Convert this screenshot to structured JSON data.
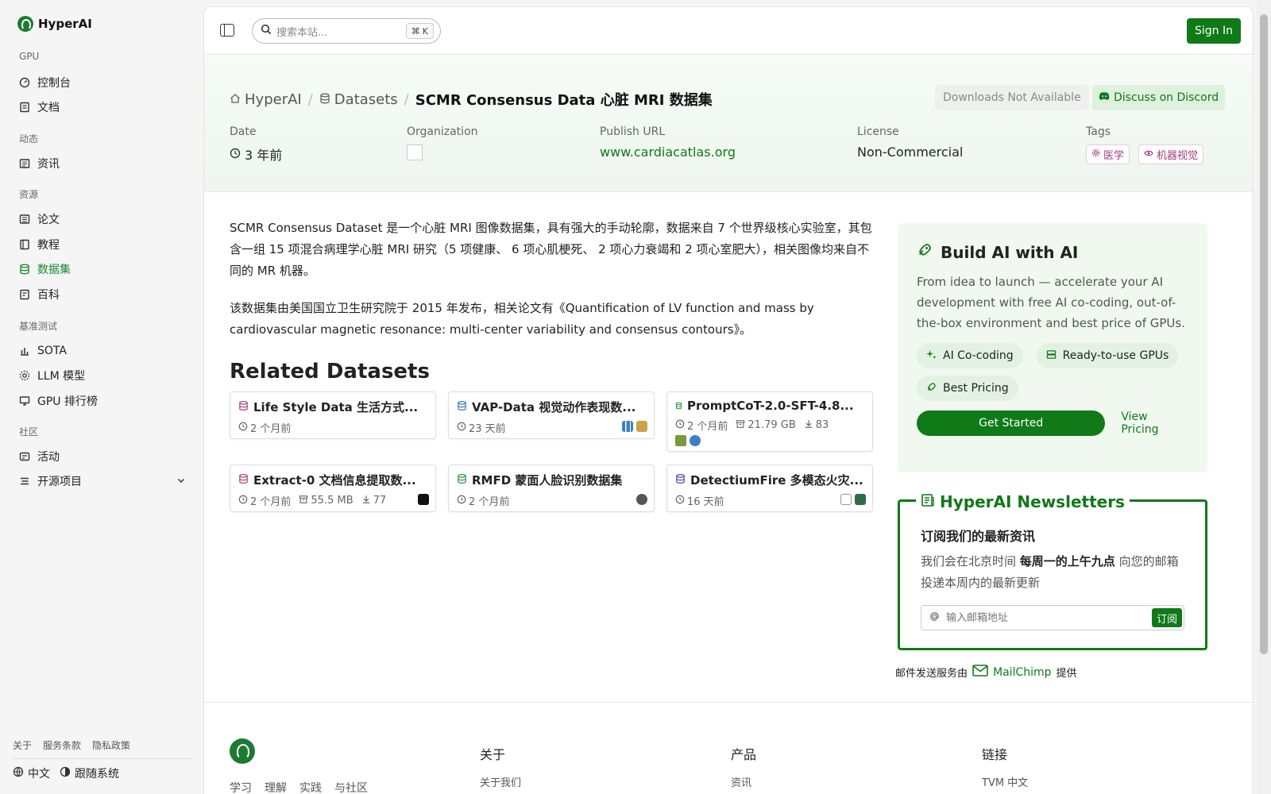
{
  "brand": {
    "name": "HyperAI"
  },
  "sidebar": {
    "sections": [
      {
        "title": "GPU",
        "items": [
          {
            "label": "控制台",
            "icon": "dashboard-icon"
          },
          {
            "label": "文档",
            "icon": "doc-icon"
          }
        ]
      },
      {
        "title": "动态",
        "items": [
          {
            "label": "资讯",
            "icon": "news-icon"
          }
        ]
      },
      {
        "title": "资源",
        "items": [
          {
            "label": "论文",
            "icon": "paper-icon"
          },
          {
            "label": "教程",
            "icon": "tutorial-icon"
          },
          {
            "label": "数据集",
            "icon": "database-icon",
            "active": true
          },
          {
            "label": "百科",
            "icon": "wiki-icon"
          }
        ]
      },
      {
        "title": "基准测试",
        "items": [
          {
            "label": "SOTA",
            "icon": "chart-icon"
          },
          {
            "label": "LLM 模型",
            "icon": "llm-icon"
          },
          {
            "label": "GPU 排行榜",
            "icon": "monitor-icon"
          }
        ]
      },
      {
        "title": "社区",
        "items": [
          {
            "label": "活动",
            "icon": "event-icon"
          },
          {
            "label": "开源项目",
            "icon": "list-icon"
          }
        ]
      }
    ],
    "footer_links": [
      "关于",
      "服务条款",
      "隐私政策"
    ],
    "language": "中文",
    "tracking": "跟随系统"
  },
  "topbar": {
    "search_placeholder": "搜索本站...",
    "shortcut": "K",
    "signin": "Sign In"
  },
  "hero": {
    "breadcrumb": [
      "HyperAI",
      "Datasets",
      "SCMR Consensus Data 心脏 MRI 数据集"
    ],
    "downloads": "Downloads Not Available",
    "discord": "Discuss on Discord",
    "meta": {
      "date_label": "Date",
      "date": "3 年前",
      "org_label": "Organization",
      "url_label": "Publish URL",
      "url": "www.cardiacatlas.org",
      "license_label": "License",
      "license": "Non-Commercial",
      "tags_label": "Tags",
      "tags": [
        "医学",
        "机器视觉"
      ]
    }
  },
  "description": {
    "p1": "SCMR Consensus Dataset 是一个心脏 MRI 图像数据集，具有强大的手动轮廓，数据来自 7 个世界级核心实验室，其包含一组 15 项混合病理学心脏 MRI 研究（5 项健康、 6 项心肌梗死、 2 项心力衰竭和 2 项心室肥大），相关图像均来自不同的 MR 机器。",
    "p2": "该数据集由美国国立卫生研究院于 2015 年发布，相关论文有《Quantification of LV function and mass by cardiovascular magnetic resonance: multi-center variability and consensus contours》。"
  },
  "related": {
    "title": "Related Datasets",
    "cards": [
      {
        "title": "Life Style Data 生活方式...",
        "time": "2 个月前",
        "color": "#b0477f"
      },
      {
        "title": "VAP-Data 视觉动作表现数...",
        "time": "23 天前",
        "color": "#3b7fc4"
      },
      {
        "title": "PromptCoT-2.0-SFT-4.8...",
        "time": "2 个月前",
        "size": "21.79 GB",
        "downloads": "83",
        "color": "#2f9a4c"
      },
      {
        "title": "Extract-0 文档信息提取数...",
        "time": "2 个月前",
        "size": "55.5 MB",
        "downloads": "77",
        "color": "#b0477f"
      },
      {
        "title": "RMFD 蒙面人脸识别数据集",
        "time": "2 个月前",
        "color": "#2f9a4c"
      },
      {
        "title": "DetectiumFire 多模态火灾...",
        "time": "16 天前",
        "color": "#5b4fb5"
      }
    ]
  },
  "promo": {
    "title": "Build AI with AI",
    "text": "From idea to launch — accelerate your AI development with free AI co-coding, out-of-the-box environment and best price of GPUs.",
    "chips": [
      "AI Co-coding",
      "Ready-to-use GPUs",
      "Best Pricing"
    ],
    "cta": "Get Started",
    "pricing": "View Pricing"
  },
  "newsletter": {
    "title": "HyperAI Newsletters",
    "subtitle": "订阅我们的最新资讯",
    "text_before": "我们会在北京时间 ",
    "text_bold": "每周一的上午九点",
    "text_after": " 向您的邮箱投递本周内的最新更新",
    "placeholder": "输入邮箱地址",
    "button": "订阅",
    "provider_prefix": "邮件发送服务由",
    "provider": "MailChimp",
    "provider_suffix": "提供"
  },
  "footer": {
    "tagline": [
      "学习",
      "理解",
      "实践",
      "与社区"
    ],
    "cols": [
      {
        "head": "关于",
        "link": "关于我们"
      },
      {
        "head": "产品",
        "link": "资讯"
      },
      {
        "head": "链接",
        "link": "TVM 中文"
      }
    ]
  },
  "colors": {
    "accent": "#0f7a17",
    "sidebar_bg": "#f5f5f5",
    "tag": "#a23a7d"
  }
}
